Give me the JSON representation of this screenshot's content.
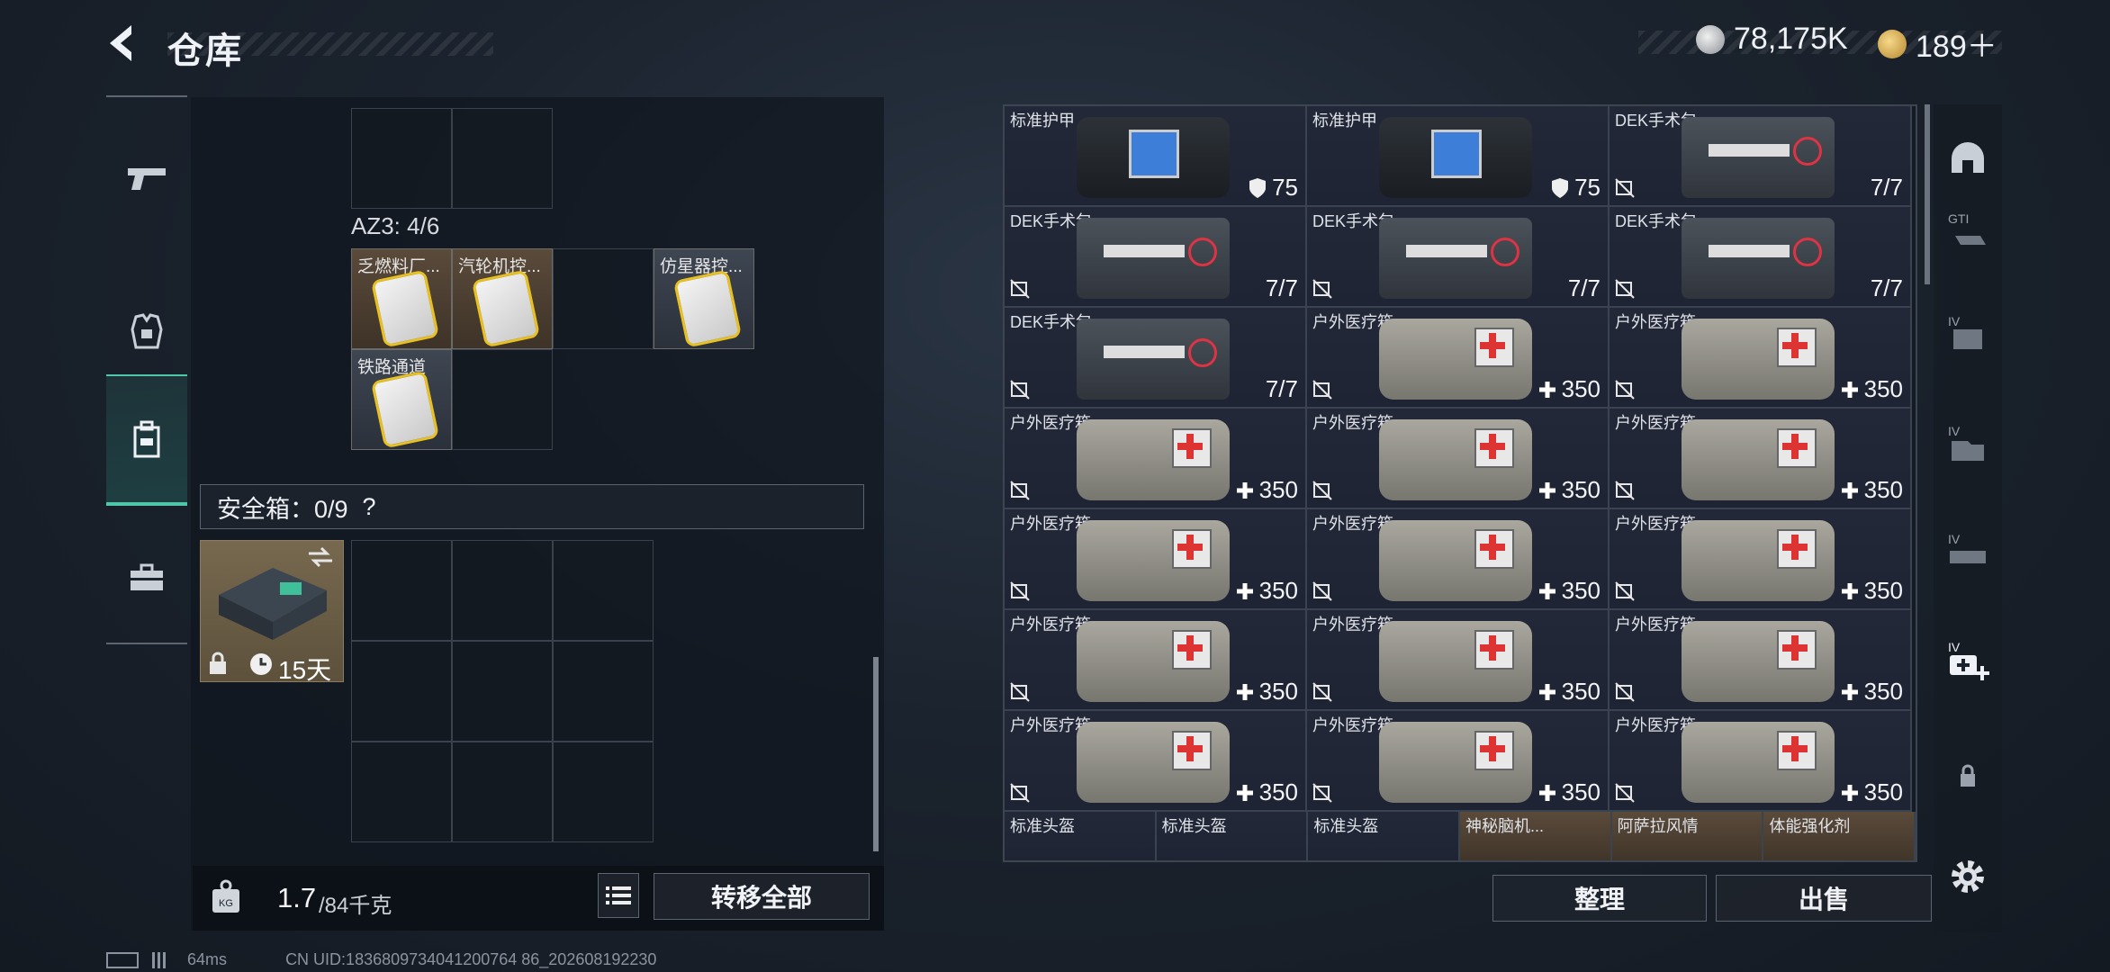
{
  "header": {
    "title": "仓库",
    "currency1": "78,175K",
    "currency2": "189＋"
  },
  "left_rail": {
    "items": [
      "weapon",
      "armor-vest",
      "backpack",
      "toolbox"
    ],
    "active": 2
  },
  "left_panel": {
    "container_label": "AZ3: 4/6",
    "slots": [
      {
        "label": "乏燃料厂..."
      },
      {
        "label": "汽轮机控..."
      },
      {
        "label": "仿星器控..."
      },
      {
        "label": "铁路通道"
      }
    ],
    "safe_label": "安全箱：0/9",
    "safe_help": "?",
    "safebox_duration": "15天",
    "weight_current": "1.7",
    "weight_max": "/84千克",
    "transfer_all": "转移全部"
  },
  "grid": {
    "rows": [
      [
        {
          "name": "标准护甲",
          "value": "75",
          "kind": "armor"
        },
        {
          "name": "标准护甲",
          "value": "75",
          "kind": "armor"
        },
        {
          "name": "DEK手术包",
          "value": "7/7",
          "kind": "surgery"
        }
      ],
      [
        {
          "name": "DEK手术包",
          "value": "7/7",
          "kind": "surgery"
        },
        {
          "name": "DEK手术包",
          "value": "7/7",
          "kind": "surgery"
        },
        {
          "name": "DEK手术包",
          "value": "7/7",
          "kind": "surgery"
        }
      ],
      [
        {
          "name": "DEK手术包",
          "value": "7/7",
          "kind": "surgery"
        },
        {
          "name": "户外医疗箱",
          "value": "350",
          "kind": "med"
        },
        {
          "name": "户外医疗箱",
          "value": "350",
          "kind": "med"
        }
      ],
      [
        {
          "name": "户外医疗箱",
          "value": "350",
          "kind": "med"
        },
        {
          "name": "户外医疗箱",
          "value": "350",
          "kind": "med"
        },
        {
          "name": "户外医疗箱",
          "value": "350",
          "kind": "med"
        }
      ],
      [
        {
          "name": "户外医疗箱",
          "value": "350",
          "kind": "med"
        },
        {
          "name": "户外医疗箱",
          "value": "350",
          "kind": "med"
        },
        {
          "name": "户外医疗箱",
          "value": "350",
          "kind": "med"
        }
      ],
      [
        {
          "name": "户外医疗箱",
          "value": "350",
          "kind": "med"
        },
        {
          "name": "户外医疗箱",
          "value": "350",
          "kind": "med"
        },
        {
          "name": "户外医疗箱",
          "value": "350",
          "kind": "med"
        }
      ],
      [
        {
          "name": "户外医疗箱",
          "value": "350",
          "kind": "med"
        },
        {
          "name": "户外医疗箱",
          "value": "350",
          "kind": "med"
        },
        {
          "name": "户外医疗箱",
          "value": "350",
          "kind": "med"
        }
      ]
    ],
    "partial_row": [
      "标准头盔",
      "标准头盔",
      "标准头盔",
      "神秘脑机...",
      "阿萨拉风情",
      "体能强化剂"
    ],
    "sort_label": "整理",
    "sell_label": "出售"
  },
  "side_rail": {
    "items": [
      "helmet-icon",
      "gti-icon",
      "iv-icon-1",
      "iv-icon-2",
      "iv-icon-3",
      "iv-med-add-icon",
      "lock-icon"
    ]
  },
  "footer": {
    "ping": "64ms",
    "uid": "CN UID:1836809734041200764 86_202608192230"
  },
  "colors": {
    "accent": "#4fc7a8",
    "panel": "#151b24",
    "item_bg": "#232839"
  }
}
